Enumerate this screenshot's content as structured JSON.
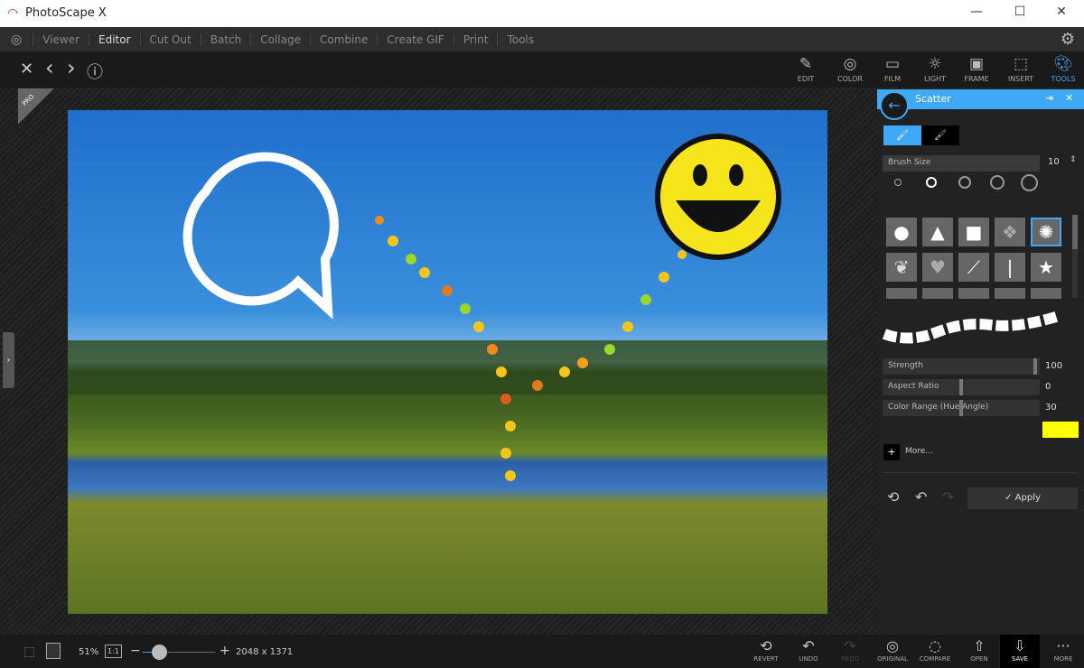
{
  "app": {
    "title": "PhotoScape X",
    "minimize": "—",
    "maximize": "☐",
    "close": "✕"
  },
  "menu": {
    "items": [
      "Viewer",
      "Editor",
      "Cut Out",
      "Batch",
      "Collage",
      "Combine",
      "Create GIF",
      "Print",
      "Tools"
    ],
    "active": "Editor"
  },
  "nav": {
    "close": "✕",
    "prev": "‹",
    "next": "›",
    "info": "ⓘ"
  },
  "tools": [
    {
      "label": "EDIT",
      "icon": "edit-icon"
    },
    {
      "label": "COLOR",
      "icon": "color-icon"
    },
    {
      "label": "FILM",
      "icon": "film-icon"
    },
    {
      "label": "LIGHT",
      "icon": "light-icon"
    },
    {
      "label": "FRAME",
      "icon": "frame-icon"
    },
    {
      "label": "INSERT",
      "icon": "insert-icon"
    },
    {
      "label": "TOOLS",
      "icon": "palette-icon",
      "active": true
    }
  ],
  "badge": "PRO",
  "panel": {
    "title": "Scatter",
    "brush_size": {
      "label": "Brush Size",
      "value": "10"
    },
    "sliders": [
      {
        "label": "Strength",
        "value": "100",
        "level": 1.0
      },
      {
        "label": "Aspect Ratio",
        "value": "0",
        "level": 0.5
      },
      {
        "label": "Color Range (Hue Angle)",
        "value": "30",
        "level": 0.5
      }
    ],
    "color": "#ffff00",
    "more": "More...",
    "apply": "Apply",
    "accent": "#3fa9f5"
  },
  "bottom": {
    "zoom": "51%",
    "one_to_one": "1:1",
    "dimensions": "2048 x 1371",
    "zoom_level": 0.25,
    "buttons": [
      "REVERT",
      "UNDO",
      "REDO",
      "ORIGINAL",
      "COMPARE",
      "OPEN",
      "SAVE",
      "MORE"
    ]
  }
}
